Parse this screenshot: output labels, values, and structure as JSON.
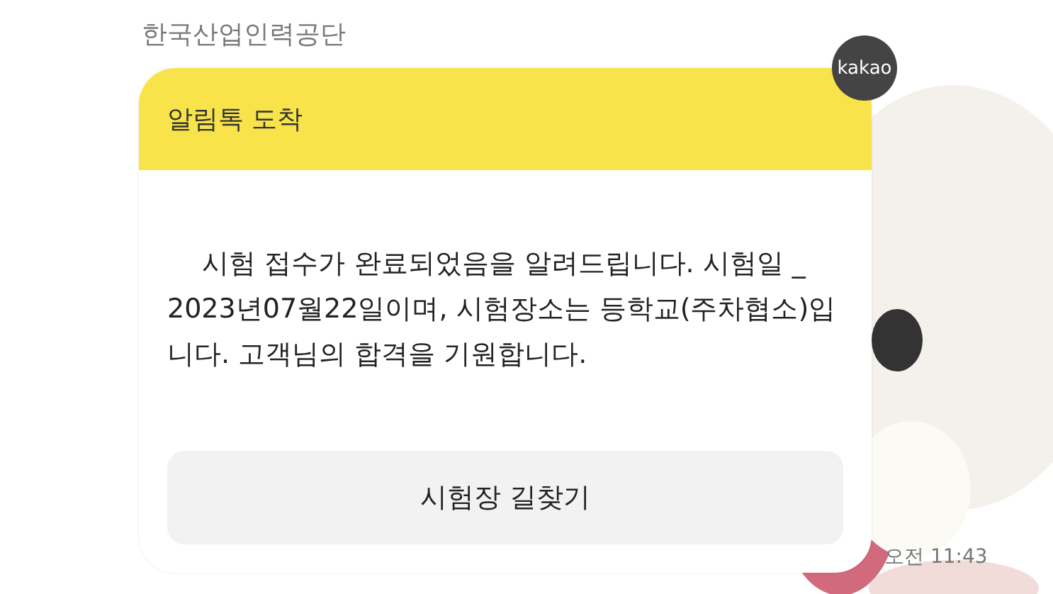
{
  "sender": {
    "name": "한국산업인력공단",
    "badge": "kakao"
  },
  "message": {
    "header": "알림톡 도착",
    "body": "시험 접수가 완료되었음을 알려드립니다. 시험일 _ 2023년07월22일이며, 시험장소는 등학교(주차협소)입니다. 고객님의 합격을 기원합니다.",
    "button": "시험장 길찾기",
    "time": "오전 11:43"
  }
}
